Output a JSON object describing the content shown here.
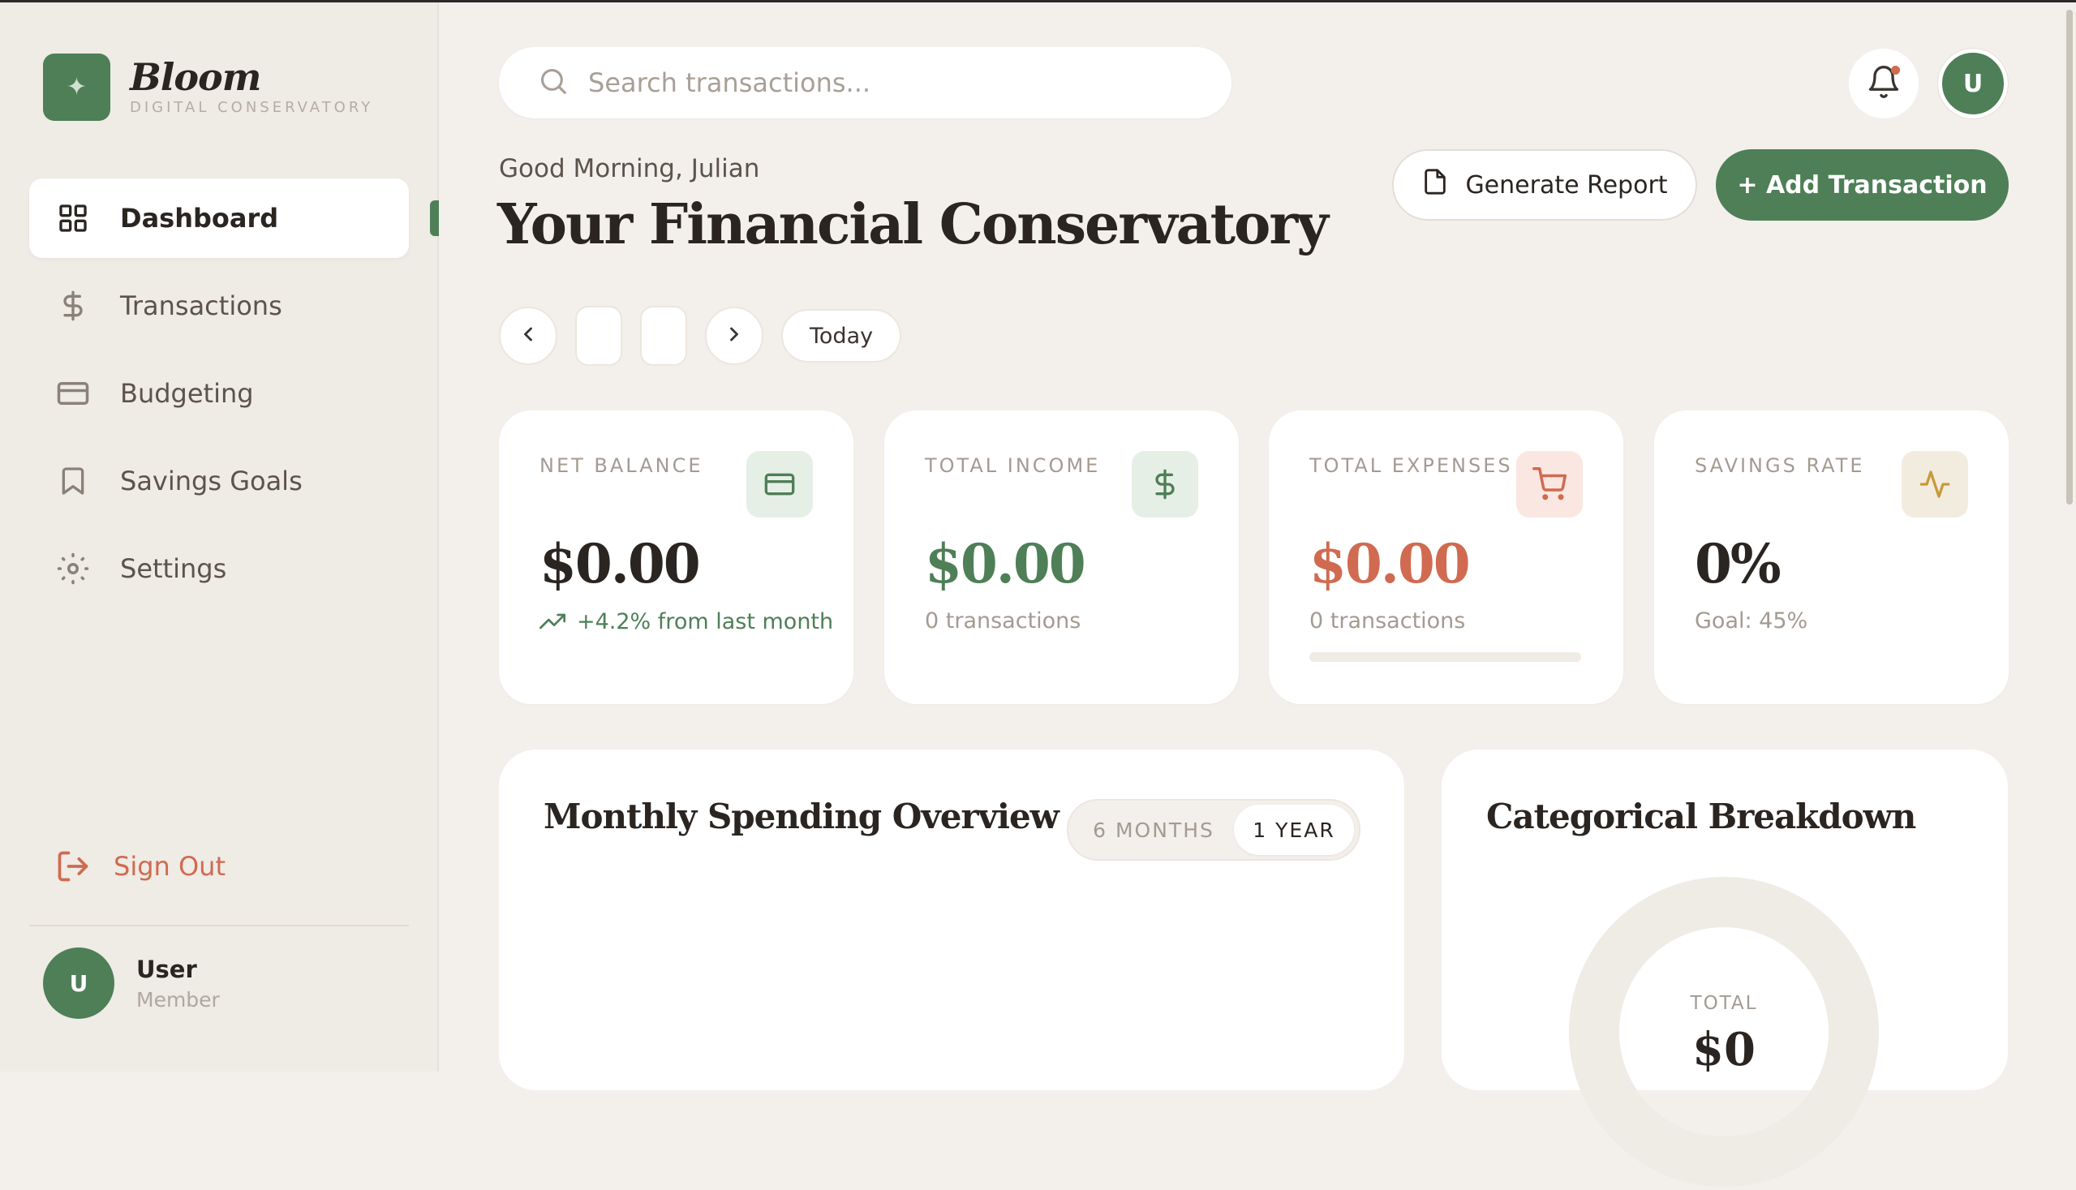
{
  "brand": {
    "name": "Bloom",
    "subtitle": "DIGITAL CONSERVATORY",
    "mark": "✦"
  },
  "sidebar": {
    "items": [
      {
        "label": "Dashboard",
        "icon": "grid-icon",
        "active": true
      },
      {
        "label": "Transactions",
        "icon": "dollar-icon"
      },
      {
        "label": "Budgeting",
        "icon": "credit-card-icon"
      },
      {
        "label": "Savings Goals",
        "icon": "bookmark-icon"
      },
      {
        "label": "Settings",
        "icon": "gear-icon"
      }
    ],
    "sign_out": "Sign Out",
    "user": {
      "initial": "U",
      "name": "User",
      "role": "Member"
    }
  },
  "header": {
    "search_placeholder": "Search transactions...",
    "avatar_initial": "U",
    "greeting": "Good Morning, Julian",
    "title": "Your Financial Conservatory",
    "report_label": "Generate Report",
    "add_label": "+ Add Transaction"
  },
  "date_nav": {
    "today_label": "Today"
  },
  "stats": [
    {
      "label": "NET BALANCE",
      "value": "$0.00",
      "sub": "+4.2% from last month",
      "icon": "card-icon",
      "color": "#2a2520",
      "icon_bg": "#e6efe6",
      "icon_color": "#4e7f57"
    },
    {
      "label": "TOTAL INCOME",
      "value": "$0.00",
      "sub": "0 transactions",
      "icon": "dollar-icon",
      "color": "#4e7f57",
      "icon_bg": "#e6efe6",
      "icon_color": "#4e7f57"
    },
    {
      "label": "TOTAL EXPENSES",
      "value": "$0.00",
      "sub": "0 transactions",
      "icon": "cart-icon",
      "color": "#d06a50",
      "icon_bg": "#fbe7e1",
      "icon_color": "#d06a50",
      "progress": 0
    },
    {
      "label": "SAVINGS RATE",
      "value": "0%",
      "sub": "Goal: 45%",
      "icon": "activity-icon",
      "color": "#2a2520",
      "icon_bg": "#f2ecdf",
      "icon_color": "#c79a3a"
    }
  ],
  "spending_panel": {
    "title": "Monthly Spending Overview",
    "options": [
      "6 MONTHS",
      "1 YEAR"
    ],
    "selected": "1 YEAR"
  },
  "category_panel": {
    "title": "Categorical Breakdown",
    "total_label": "TOTAL",
    "total_value": "$0"
  },
  "colors": {
    "accent": "#4e7f57",
    "danger": "#d06a50",
    "background": "#f3f0eb"
  }
}
